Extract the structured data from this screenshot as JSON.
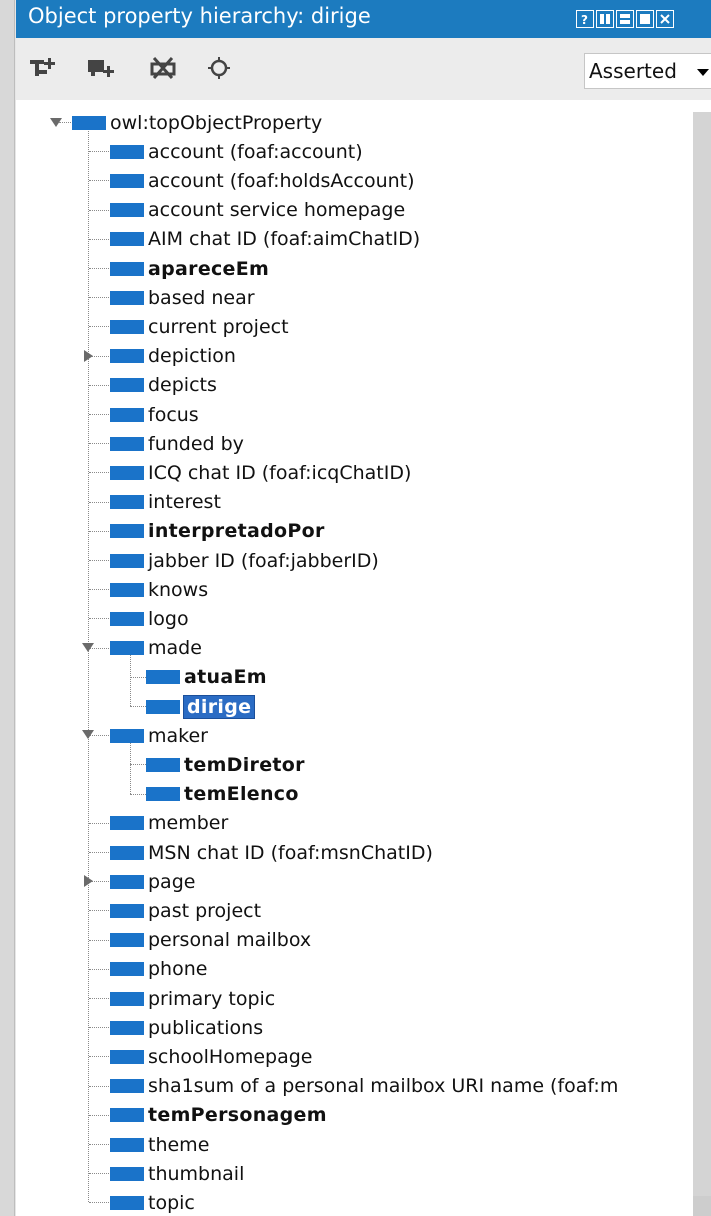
{
  "panel": {
    "title": "Object property hierarchy: dirige",
    "view_mode": "Asserted",
    "toolbar_icons": [
      "add-subproperty-icon",
      "add-sibling-property-icon",
      "delete-property-icon",
      "search-icon"
    ],
    "window_buttons": [
      "help-icon",
      "split-vertical-icon",
      "split-horizontal-icon",
      "maximize-icon",
      "close-icon"
    ]
  },
  "colors": {
    "titlebar": "#1c7bbf",
    "property_icon": "#1a73c9",
    "selection": "#2b6cc4"
  },
  "tree": {
    "root": "owl:topObjectProperty",
    "items": [
      {
        "label": "account (foaf:account)",
        "bold": false
      },
      {
        "label": "account (foaf:holdsAccount)",
        "bold": false
      },
      {
        "label": "account service homepage",
        "bold": false
      },
      {
        "label": "AIM chat ID (foaf:aimChatID)",
        "bold": false
      },
      {
        "label": "apareceEm",
        "bold": true
      },
      {
        "label": "based near",
        "bold": false
      },
      {
        "label": "current project",
        "bold": false
      },
      {
        "label": "depiction",
        "bold": false,
        "collapsed": true
      },
      {
        "label": "depicts",
        "bold": false
      },
      {
        "label": "focus",
        "bold": false
      },
      {
        "label": "funded by",
        "bold": false
      },
      {
        "label": "ICQ chat ID (foaf:icqChatID)",
        "bold": false
      },
      {
        "label": "interest",
        "bold": false
      },
      {
        "label": "interpretadoPor",
        "bold": true
      },
      {
        "label": "jabber ID (foaf:jabberID)",
        "bold": false
      },
      {
        "label": "knows",
        "bold": false
      },
      {
        "label": "logo",
        "bold": false
      },
      {
        "label": "made",
        "bold": false,
        "expanded": true
      },
      {
        "label": "atuaEm",
        "bold": true,
        "level": 2
      },
      {
        "label": "dirige",
        "bold": true,
        "level": 2,
        "selected": true
      },
      {
        "label": "maker",
        "bold": false,
        "expanded": true
      },
      {
        "label": "temDiretor",
        "bold": true,
        "level": 2
      },
      {
        "label": "temElenco",
        "bold": true,
        "level": 2
      },
      {
        "label": "member",
        "bold": false
      },
      {
        "label": "MSN chat ID (foaf:msnChatID)",
        "bold": false
      },
      {
        "label": "page",
        "bold": false,
        "collapsed": true
      },
      {
        "label": "past project",
        "bold": false
      },
      {
        "label": "personal mailbox",
        "bold": false
      },
      {
        "label": "phone",
        "bold": false
      },
      {
        "label": "primary topic",
        "bold": false
      },
      {
        "label": "publications",
        "bold": false
      },
      {
        "label": "schoolHomepage",
        "bold": false
      },
      {
        "label": "sha1sum of a personal mailbox URI name (foaf:m",
        "bold": false
      },
      {
        "label": "temPersonagem",
        "bold": true
      },
      {
        "label": "theme",
        "bold": false
      },
      {
        "label": "thumbnail",
        "bold": false
      },
      {
        "label": "topic",
        "bold": false
      }
    ]
  }
}
